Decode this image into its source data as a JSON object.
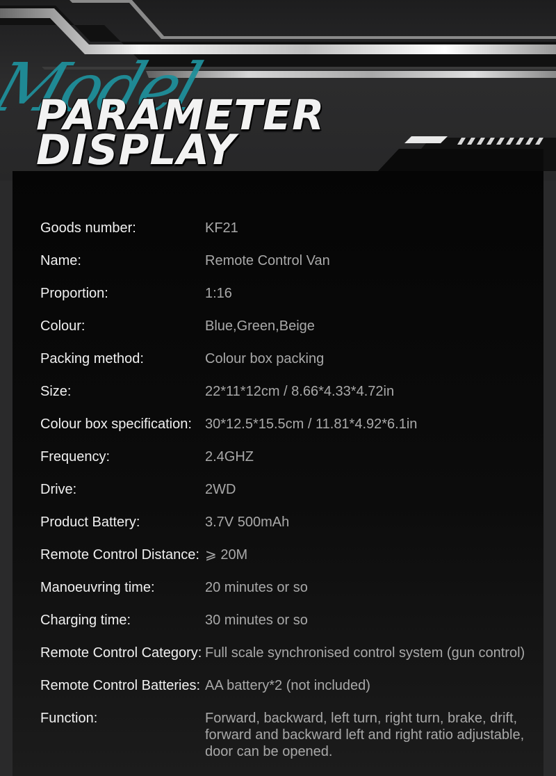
{
  "header": {
    "script_word": "Model",
    "title_line1": "PARAMETER",
    "title_line2": "DISPLAY"
  },
  "specs": [
    {
      "label": "Goods number:",
      "value": "KF21"
    },
    {
      "label": "Name:",
      "value": "Remote Control Van"
    },
    {
      "label": "Proportion:",
      "value": "1:16"
    },
    {
      "label": "Colour:",
      "value": "Blue,Green,Beige"
    },
    {
      "label": "Packing method:",
      "value": "Colour box packing"
    },
    {
      "label": "Size:",
      "value": "22*11*12cm / 8.66*4.33*4.72in"
    },
    {
      "label": "Colour box specification:",
      "value": "30*12.5*15.5cm / 11.81*4.92*6.1in"
    },
    {
      "label": "Frequency:",
      "value": "2.4GHZ"
    },
    {
      "label": "Drive:",
      "value": "2WD"
    },
    {
      "label": "Product Battery:",
      "value": "3.7V 500mAh"
    },
    {
      "label": "Remote Control Distance:",
      "value": "⩾ 20M"
    },
    {
      "label": "Manoeuvring time:",
      "value": "20 minutes or so"
    },
    {
      "label": "Charging time:",
      "value": "30 minutes or so"
    },
    {
      "label": "Remote Control Category:",
      "value": "Full scale synchronised control system (gun control)"
    },
    {
      "label": "Remote Control Batteries:",
      "value": "AA battery*2 (not included)"
    },
    {
      "label": "Function:",
      "value": "Forward, backward, left turn, right turn, brake, drift, forward and backward left and right ratio adjustable, door can be opened."
    }
  ]
}
